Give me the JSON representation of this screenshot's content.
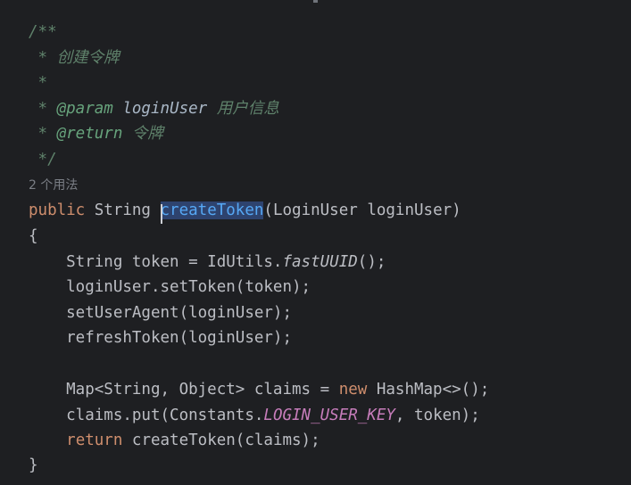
{
  "comment": {
    "open": "/**",
    "desc": " * 创建令牌",
    "blank": " *",
    "param_star": " * ",
    "param_tag": "@param",
    "param_name": " loginUser",
    "param_desc": " 用户信息",
    "return_star": " * ",
    "return_tag": "@return",
    "return_desc": " 令牌",
    "close": " */"
  },
  "usage_hint": "2 个用法",
  "signature": {
    "modifier": "public",
    "return_type": " String ",
    "method": "createToken",
    "params": "(LoginUser loginUser)"
  },
  "body": {
    "open_brace": "{",
    "l1_a": "    String token = IdUtils.",
    "l1_b": "fastUUID",
    "l1_c": "();",
    "l2": "    loginUser.setToken(token);",
    "l3": "    setUserAgent(loginUser);",
    "l4": "    refreshToken(loginUser);",
    "l5_a": "    Map<String, Object> claims = ",
    "l5_kw": "new",
    "l5_b": " HashMap<>();",
    "l6_a": "    claims.put(Constants.",
    "l6_const": "LOGIN_USER_KEY",
    "l6_b": ", token);",
    "l7_indent": "    ",
    "l7_kw": "return",
    "l7_b": " createToken(claims);",
    "close_brace": "}"
  }
}
